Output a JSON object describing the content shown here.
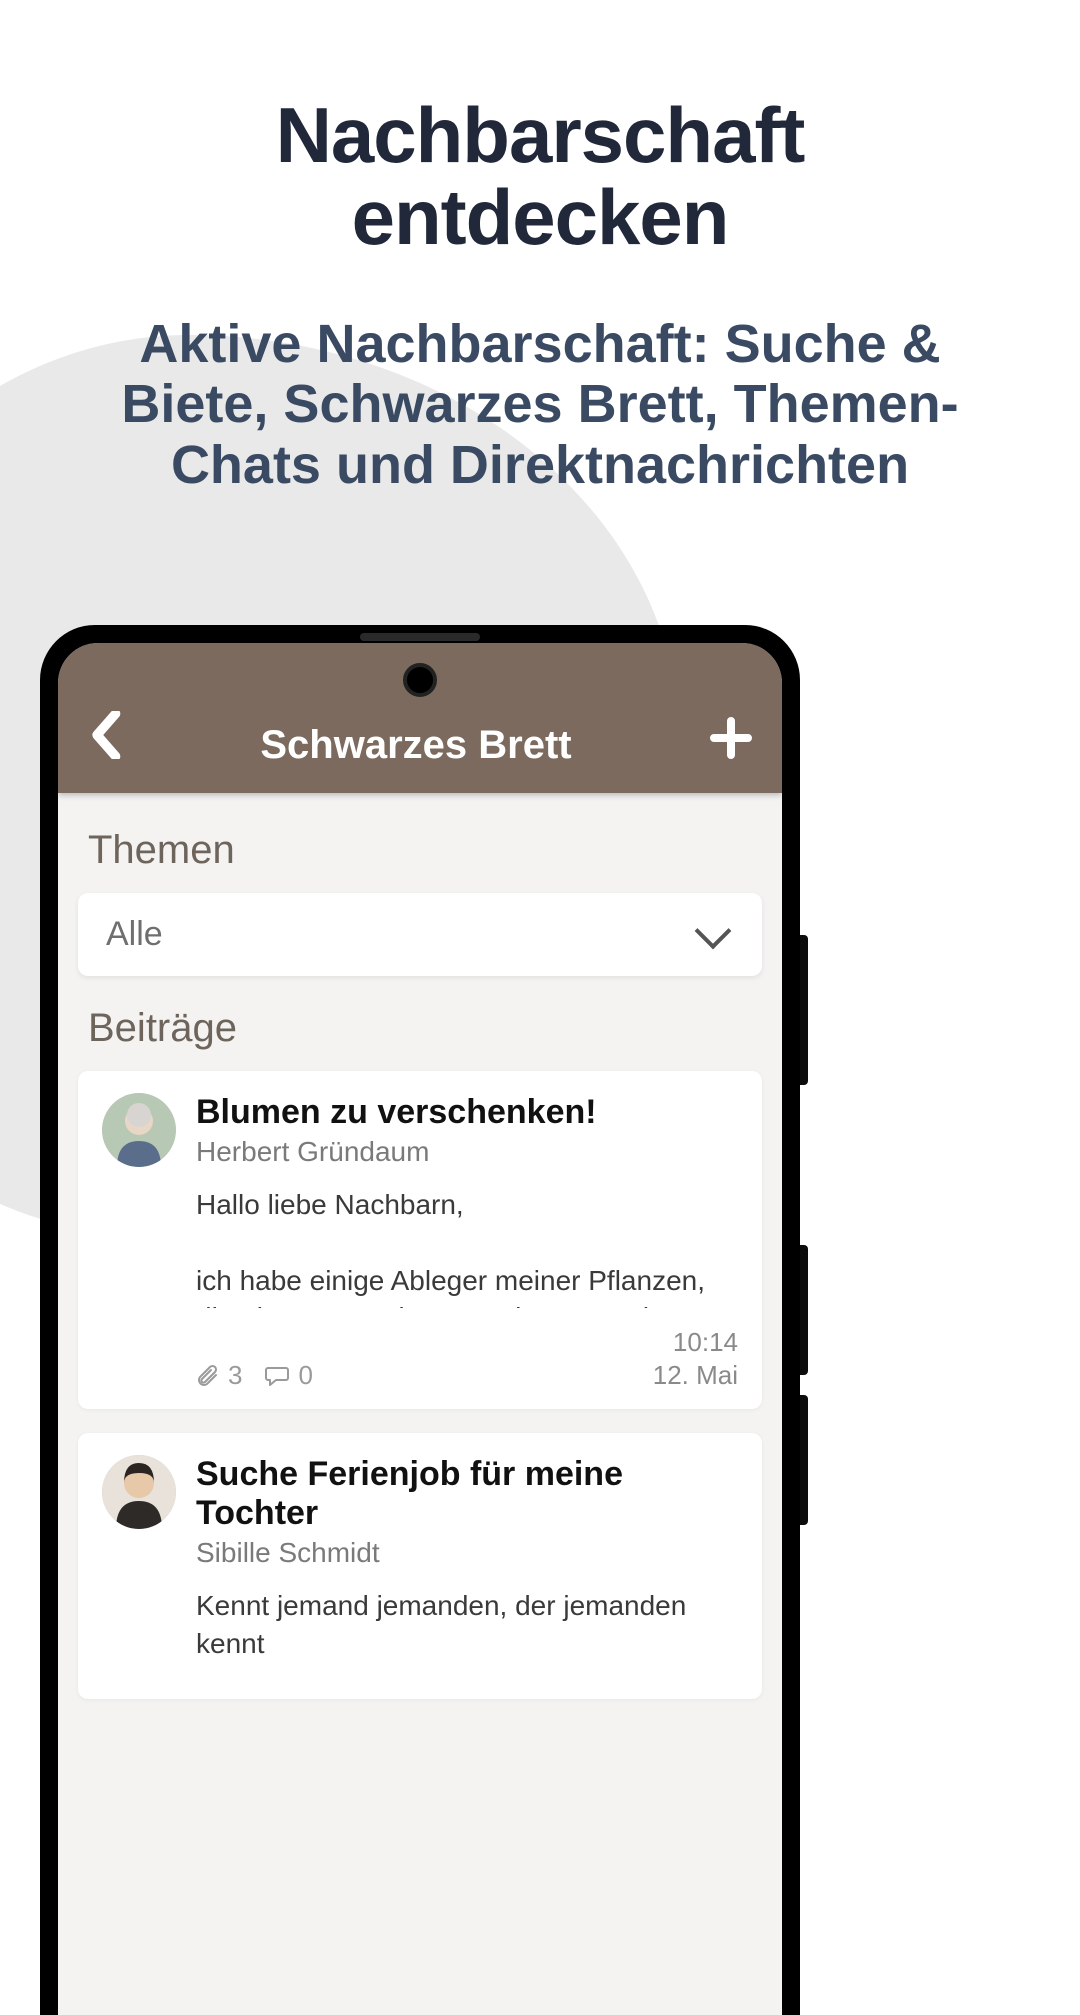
{
  "marketing": {
    "title_line1": "Nachbarschaft",
    "title_line2": "entdecken",
    "subtitle": "Aktive Nachbarschaft: Suche & Biete, Schwarzes Brett, Themen-Chats und Direktnachrichten"
  },
  "app": {
    "header": {
      "title": "Schwarzes Brett"
    },
    "themen": {
      "label": "Themen",
      "dropdown_value": "Alle"
    },
    "beitraege": {
      "label": "Beiträge",
      "posts": [
        {
          "title": "Blumen zu verschenken!",
          "author": "Herbert Gründaum",
          "body": "Hallo liebe Nachbarn,\n\nich habe einige Ableger meiner Pflanzen, die ein neues schönes Zuhause suchen. Meldet…",
          "attachments": "3",
          "comments": "0",
          "time": "10:14",
          "date": "12. Mai"
        },
        {
          "title": "Suche Ferienjob für meine Tochter",
          "author": "Sibille Schmidt",
          "body": "Kennt jemand jemanden, der jemanden kennt"
        }
      ]
    }
  }
}
